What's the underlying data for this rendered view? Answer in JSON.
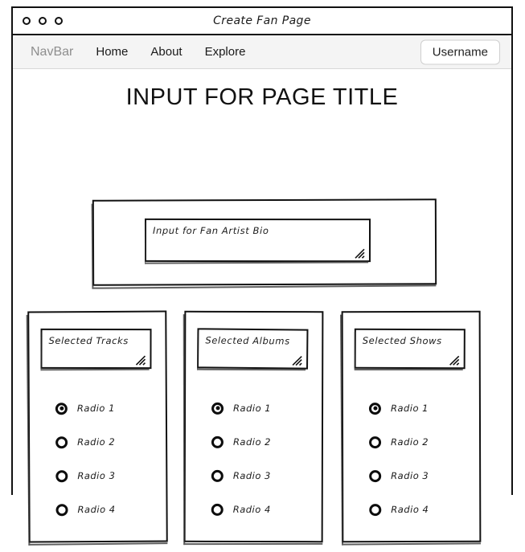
{
  "window": {
    "title": "Create Fan Page",
    "dots": [
      "window-dot-1",
      "window-dot-2",
      "window-dot-3"
    ]
  },
  "navbar": {
    "brand": "NavBar",
    "links": [
      {
        "label": "Home"
      },
      {
        "label": "About"
      },
      {
        "label": "Explore"
      }
    ],
    "user_button": "Username"
  },
  "main": {
    "page_title": "INPUT FOR PAGE TITLE",
    "bio": {
      "value": "Input for Fan Artist Bio",
      "resize_icon": "resize-grip-icon"
    },
    "columns": [
      {
        "title": "Selected Tracks",
        "resize_icon": "resize-grip-icon",
        "options": [
          {
            "label": "Radio 1",
            "checked": true
          },
          {
            "label": "Radio 2",
            "checked": false
          },
          {
            "label": "Radio 3",
            "checked": false
          },
          {
            "label": "Radio 4",
            "checked": false
          }
        ]
      },
      {
        "title": "Selected Albums",
        "resize_icon": "resize-grip-icon",
        "options": [
          {
            "label": "Radio 1",
            "checked": true
          },
          {
            "label": "Radio 2",
            "checked": false
          },
          {
            "label": "Radio 3",
            "checked": false
          },
          {
            "label": "Radio 4",
            "checked": false
          }
        ]
      },
      {
        "title": "Selected Shows",
        "resize_icon": "resize-grip-icon",
        "options": [
          {
            "label": "Radio 1",
            "checked": true
          },
          {
            "label": "Radio 2",
            "checked": false
          },
          {
            "label": "Radio 3",
            "checked": false
          },
          {
            "label": "Radio 4",
            "checked": false
          }
        ]
      }
    ]
  },
  "colors": {
    "stroke": "#111111",
    "navbar_bg": "#f4f4f4",
    "brand_text": "#8e8e8e",
    "page_bg": "#ffffff"
  }
}
